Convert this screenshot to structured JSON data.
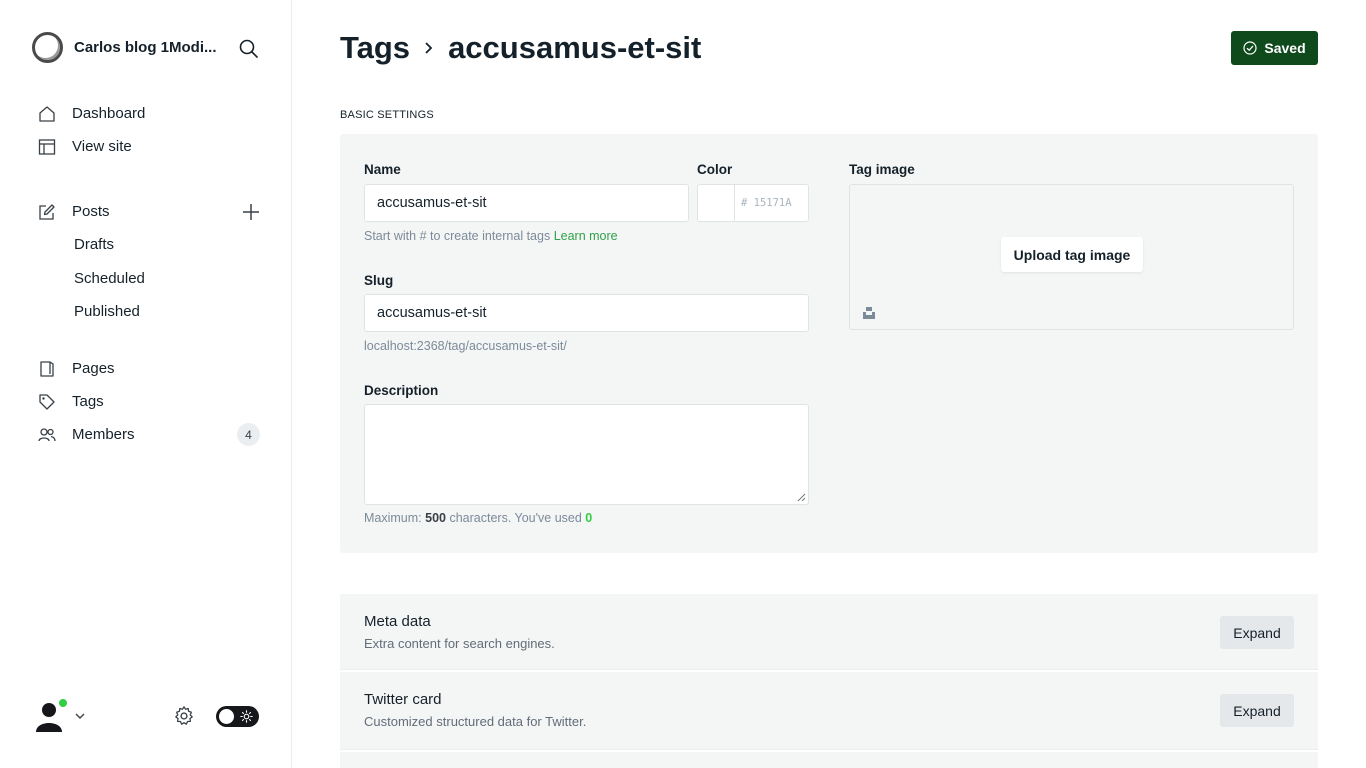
{
  "sidebar": {
    "site_name": "Carlos blog 1Modi...",
    "nav": {
      "dashboard": "Dashboard",
      "view_site": "View site",
      "posts": "Posts",
      "drafts": "Drafts",
      "scheduled": "Scheduled",
      "published": "Published",
      "pages": "Pages",
      "tags": "Tags",
      "members": "Members",
      "members_count": "4"
    }
  },
  "header": {
    "breadcrumb_root": "Tags",
    "breadcrumb_current": "accusamus-et-sit",
    "saved_label": "Saved"
  },
  "basic_settings": {
    "section_label": "BASIC SETTINGS",
    "name_label": "Name",
    "name_value": "accusamus-et-sit",
    "name_hint": "Start with # to create internal tags ",
    "name_hint_link": "Learn more",
    "color_label": "Color",
    "color_hex": "# 15171A",
    "slug_label": "Slug",
    "slug_value": "accusamus-et-sit",
    "slug_url": "localhost:2368/tag/accusamus-et-sit/",
    "description_label": "Description",
    "desc_hint_prefix": "Maximum: ",
    "desc_max": "500",
    "desc_hint_mid": " characters. You've used ",
    "desc_used": "0",
    "tag_image_label": "Tag image",
    "upload_label": "Upload tag image"
  },
  "cards": [
    {
      "title": "Meta data",
      "subtitle": "Extra content for search engines.",
      "button": "Expand"
    },
    {
      "title": "Twitter card",
      "subtitle": "Customized structured data for Twitter.",
      "button": "Expand"
    }
  ],
  "colors": {
    "accent_green": "#30cf43",
    "saved_bg": "#0f4a1d",
    "panel_bg": "#f4f5f5"
  }
}
